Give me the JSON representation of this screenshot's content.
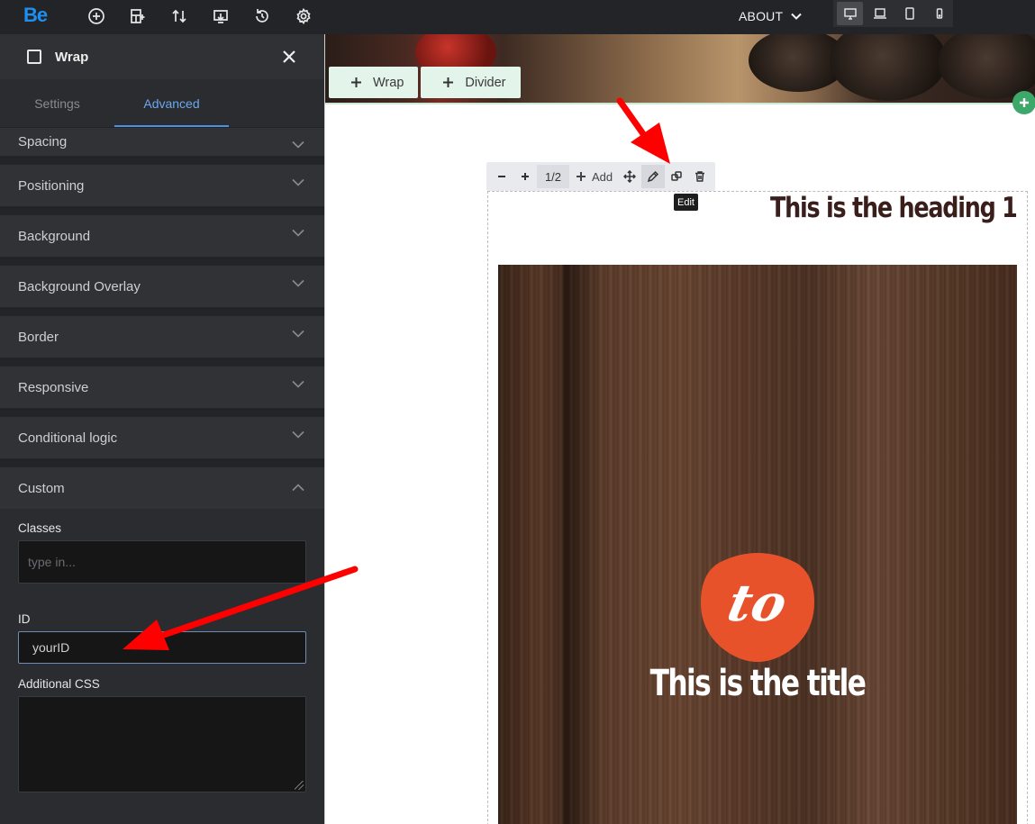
{
  "topbar": {
    "logo": "Be",
    "nav_about": "ABOUT"
  },
  "sidebar": {
    "title": "Wrap",
    "tabs": [
      {
        "label": "Settings"
      },
      {
        "label": "Advanced"
      }
    ],
    "sections": [
      {
        "label": "Spacing"
      },
      {
        "label": "Positioning"
      },
      {
        "label": "Background"
      },
      {
        "label": "Background Overlay"
      },
      {
        "label": "Border"
      },
      {
        "label": "Responsive"
      },
      {
        "label": "Conditional logic"
      },
      {
        "label": "Custom"
      }
    ],
    "custom": {
      "classes_label": "Classes",
      "classes_placeholder": "type in...",
      "id_label": "ID",
      "id_value": "yourID",
      "css_label": "Additional CSS"
    }
  },
  "canvas": {
    "add_wrap": "Wrap",
    "add_divider": "Divider",
    "toolbar": {
      "size": "1/2",
      "add_label": "Add",
      "tooltip": "Edit"
    },
    "heading": "This is the heading 1",
    "badge_text": "to",
    "title": "This is the title"
  },
  "colors": {
    "accent": "#4d8fe0",
    "logo": "#1e8ff0",
    "badge": "#e8522a",
    "annotation_arrow": "#ff0000",
    "add_green": "#3ea86a"
  }
}
